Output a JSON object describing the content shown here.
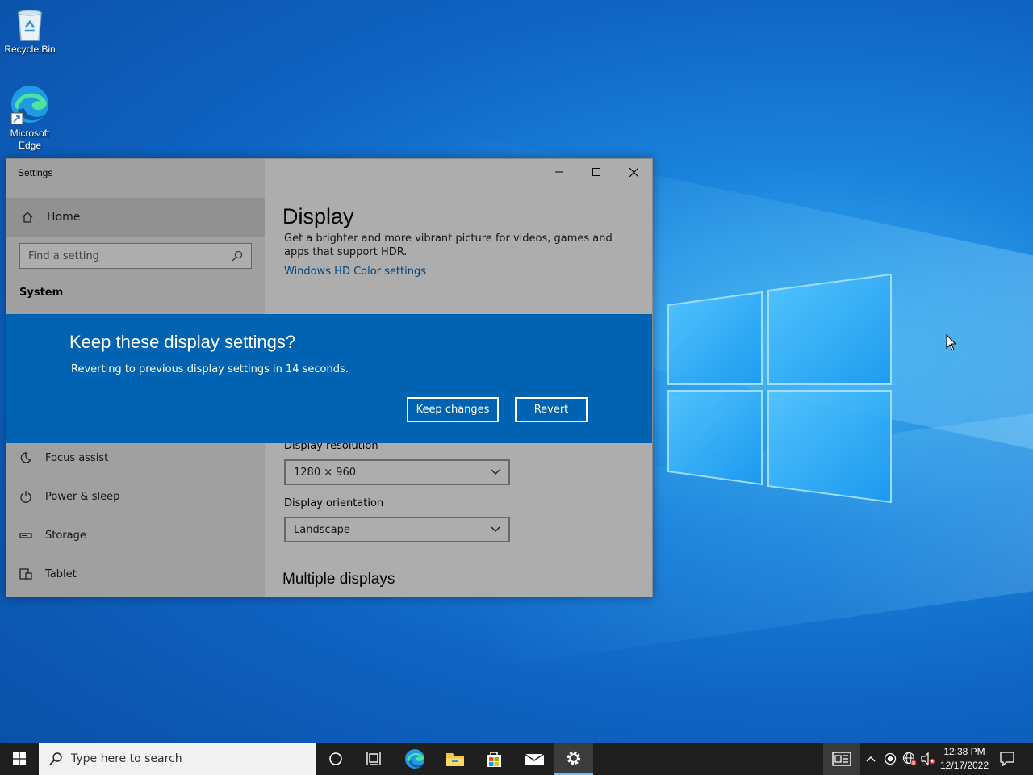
{
  "desktop": {
    "icons": [
      {
        "label": "Recycle Bin"
      },
      {
        "label": "Microsoft Edge"
      }
    ]
  },
  "settings_window": {
    "title": "Settings",
    "sidebar": {
      "home": "Home",
      "search_placeholder": "Find a setting",
      "section": "System",
      "items": [
        {
          "label": "Focus assist",
          "icon": "moon-icon"
        },
        {
          "label": "Power & sleep",
          "icon": "power-icon"
        },
        {
          "label": "Storage",
          "icon": "storage-icon"
        },
        {
          "label": "Tablet",
          "icon": "tablet-icon"
        }
      ]
    },
    "content": {
      "heading": "Display",
      "hdr_description": "Get a brighter and more vibrant picture for videos, games and apps that support HDR.",
      "hdr_link": "Windows HD Color settings",
      "resolution_label": "Display resolution",
      "resolution_value": "1280 × 960",
      "orientation_label": "Display orientation",
      "orientation_value": "Landscape",
      "multiple_displays": "Multiple displays"
    }
  },
  "dialog": {
    "title": "Keep these display settings?",
    "message": "Reverting to previous display settings in 14 seconds.",
    "keep_label": "Keep changes",
    "revert_label": "Revert"
  },
  "taskbar": {
    "search_placeholder": "Type here to search",
    "time": "12:38 PM",
    "date": "12/17/2022"
  },
  "colors": {
    "accent": "#0063b1",
    "taskbar": "#1f1f1f"
  }
}
